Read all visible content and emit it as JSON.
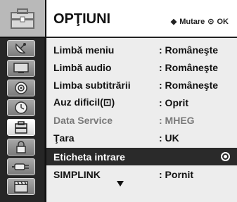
{
  "header": {
    "title": "OPŢIUNI",
    "hint_move_glyph": "◆",
    "hint_move": "Mutare",
    "hint_ok_glyph": "⊙",
    "hint_ok": "OK"
  },
  "sidebar": {
    "items": [
      {
        "icon": "toolbox-icon",
        "selected": false
      },
      {
        "icon": "satellite-dish-icon",
        "selected": false
      },
      {
        "icon": "tv-screen-icon",
        "selected": false
      },
      {
        "icon": "speaker-icon",
        "selected": false
      },
      {
        "icon": "clock-icon",
        "selected": false
      },
      {
        "icon": "options-icon",
        "selected": true
      },
      {
        "icon": "lock-icon",
        "selected": false
      },
      {
        "icon": "input-plug-icon",
        "selected": false
      },
      {
        "icon": "clapperboard-icon",
        "selected": false
      }
    ]
  },
  "menu": {
    "rows": [
      {
        "label": "Limbă meniu",
        "value": ": Româneşte"
      },
      {
        "label": "Limbă audio",
        "value": ": Româneşte"
      },
      {
        "label": "Limba subtitrării",
        "value": ": Româneşte"
      },
      {
        "label": "Auz dificil(⊡)",
        "value": ": Oprit"
      },
      {
        "label": "Data Service",
        "value": ": MHEG"
      },
      {
        "label": "Ţara",
        "value": ": UK"
      },
      {
        "label": "Eticheta intrare",
        "value": ""
      },
      {
        "label": "SIMPLINK",
        "value": ": Pornit"
      }
    ]
  },
  "colors": {
    "highlight": "#2a2a2a",
    "panel": "#ededed",
    "disabled_text": "#7a7a7a"
  }
}
